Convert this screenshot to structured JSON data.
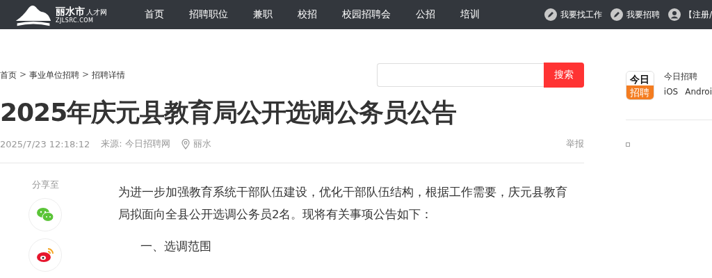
{
  "header": {
    "logo": {
      "name": "丽水市",
      "tag": "人才网",
      "domain": "ZJLSRC.COM"
    },
    "nav": [
      {
        "label": "首页",
        "selected": false
      },
      {
        "label": "招聘职位",
        "selected": false
      },
      {
        "label": "兼职",
        "selected": false
      },
      {
        "label": "校招",
        "selected": false
      },
      {
        "label": "校园招聘会",
        "selected": false
      },
      {
        "label": "公招",
        "selected": false
      },
      {
        "label": "培训",
        "selected": false
      }
    ],
    "actions": [
      {
        "kind": "edit",
        "label": "我要找工作"
      },
      {
        "kind": "edit",
        "label": "我要招聘"
      },
      {
        "kind": "user",
        "label": "【注册/"
      }
    ]
  },
  "breadcrumb": [
    "首页",
    "事业单位招聘",
    "招聘详情"
  ],
  "breadcrumb_separator": ">",
  "search": {
    "button": "搜索"
  },
  "article": {
    "title": "2025年庆元县教育局公开选调公务员公告",
    "date": "2025/7/23 12:18:12",
    "source": "来源: 今日招聘网",
    "location": "丽水",
    "report": "举报",
    "paragraphs": [
      "为进一步加强教育系统干部队伍建设，优化干部队伍结构，根据工作需要，庆元县教育局拟面向全县公开选调公务员2名。现将有关事项公告如下：",
      "一、选调范围"
    ]
  },
  "share": {
    "label": "分享至",
    "targets": [
      {
        "kind": "wechat"
      },
      {
        "kind": "weibo"
      }
    ]
  },
  "sidebar": {
    "app": {
      "icon_top": "今日",
      "icon_bottom": "招聘",
      "name": "今日招聘",
      "platforms": [
        "iOS",
        "Androi"
      ]
    }
  }
}
